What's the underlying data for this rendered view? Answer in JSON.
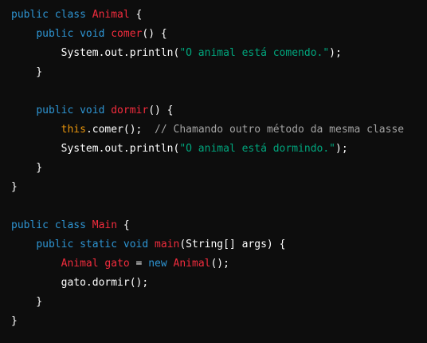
{
  "colors": {
    "background": "#0d0d0d",
    "keyword": "#2e95d3",
    "identifier": "#f22c3d",
    "plain": "#ffffff",
    "string": "#00a67d",
    "comment": "#a3a3a3",
    "this": "#e9950c"
  },
  "code_lines": [
    [
      [
        "public class ",
        "keyword"
      ],
      [
        "Animal",
        "identifier"
      ],
      [
        " {",
        "plain"
      ]
    ],
    [
      [
        "    ",
        "plain"
      ],
      [
        "public void ",
        "keyword"
      ],
      [
        "comer",
        "identifier"
      ],
      [
        "() {",
        "plain"
      ]
    ],
    [
      [
        "        System.out.println(",
        "plain"
      ],
      [
        "\"O animal está comendo.\"",
        "string"
      ],
      [
        ");",
        "plain"
      ]
    ],
    [
      [
        "    }",
        "plain"
      ]
    ],
    [],
    [
      [
        "    ",
        "plain"
      ],
      [
        "public void ",
        "keyword"
      ],
      [
        "dormir",
        "identifier"
      ],
      [
        "() {",
        "plain"
      ]
    ],
    [
      [
        "        ",
        "plain"
      ],
      [
        "this",
        "this"
      ],
      [
        ".comer();  ",
        "plain"
      ],
      [
        "// Chamando outro método da mesma classe",
        "comment"
      ]
    ],
    [
      [
        "        System.out.println(",
        "plain"
      ],
      [
        "\"O animal está dormindo.\"",
        "string"
      ],
      [
        ");",
        "plain"
      ]
    ],
    [
      [
        "    }",
        "plain"
      ]
    ],
    [
      [
        "}",
        "plain"
      ]
    ],
    [],
    [
      [
        "public class ",
        "keyword"
      ],
      [
        "Main",
        "identifier"
      ],
      [
        " {",
        "plain"
      ]
    ],
    [
      [
        "    ",
        "plain"
      ],
      [
        "public static void ",
        "keyword"
      ],
      [
        "main",
        "identifier"
      ],
      [
        "(String[] args) {",
        "plain"
      ]
    ],
    [
      [
        "        ",
        "plain"
      ],
      [
        "Animal gato",
        "identifier"
      ],
      [
        " = ",
        "plain"
      ],
      [
        "new ",
        "keyword"
      ],
      [
        "Animal",
        "identifier"
      ],
      [
        "();",
        "plain"
      ]
    ],
    [
      [
        "        gato.dormir();",
        "plain"
      ]
    ],
    [
      [
        "    }",
        "plain"
      ]
    ],
    [
      [
        "}",
        "plain"
      ]
    ]
  ]
}
